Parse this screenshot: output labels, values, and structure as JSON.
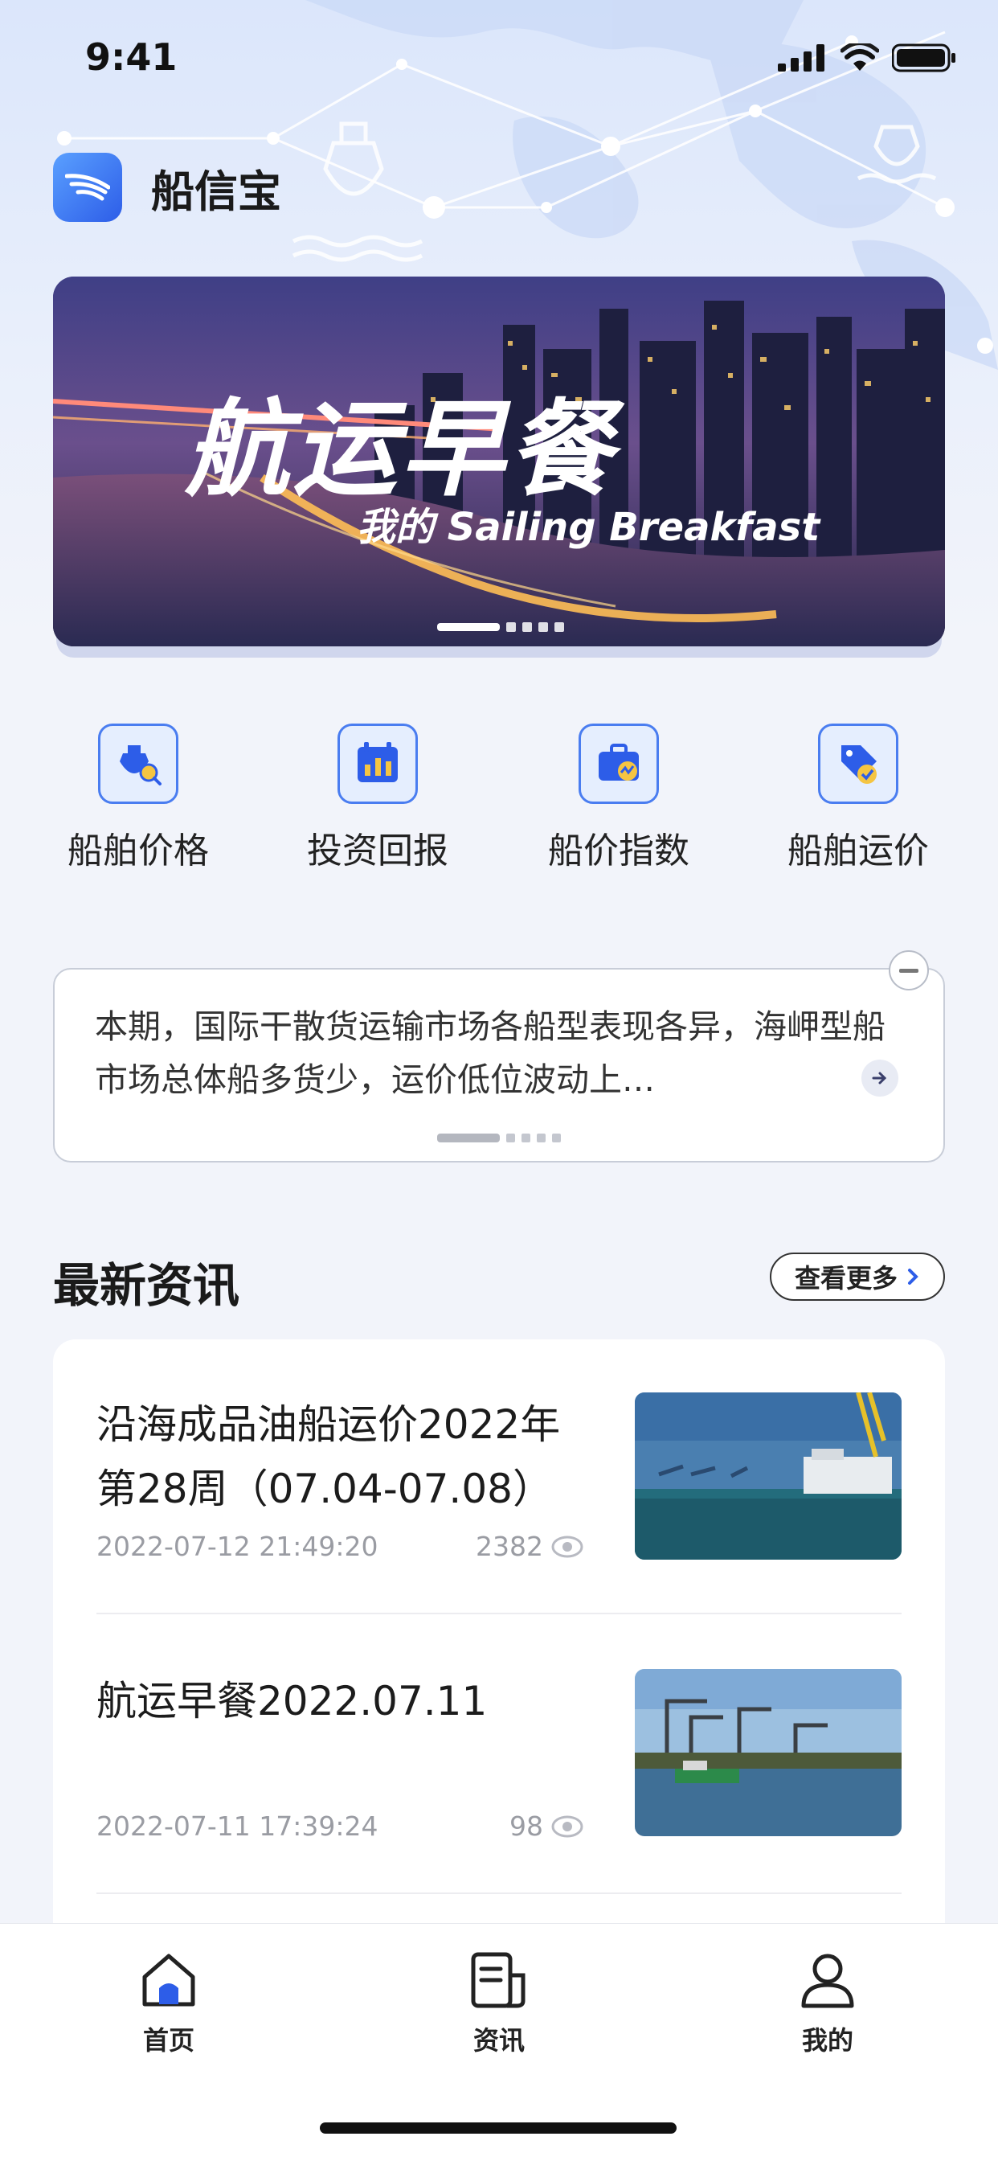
{
  "status_bar": {
    "time": "9:41"
  },
  "app": {
    "name": "船信宝"
  },
  "banner": {
    "title": "航运早餐",
    "subtitle": "我的 Sailing Breakfast",
    "page_count": 5,
    "active_index": 0
  },
  "quick_nav": [
    {
      "label": "船舶价格",
      "icon": "ship-search-icon"
    },
    {
      "label": "投资回报",
      "icon": "bar-chart-calendar-icon"
    },
    {
      "label": "船价指数",
      "icon": "briefcase-chart-icon"
    },
    {
      "label": "船舶运价",
      "icon": "price-tag-check-icon"
    }
  ],
  "notice": {
    "text": "本期，国际干散货运输市场各船型表现各异，海岬型船市场总体船多货少，运价低位波动上…",
    "page_count": 5,
    "active_index": 0
  },
  "news": {
    "section_title": "最新资讯",
    "more_label": "查看更多",
    "items": [
      {
        "title": "沿海成品油船运价2022年第28周（07.04-07.08）",
        "date": "2022-07-12 21:49:20",
        "views": "2382"
      },
      {
        "title": "航运早餐2022.07.11",
        "date": "2022-07-11 17:39:24",
        "views": "98"
      }
    ]
  },
  "tabbar": {
    "tabs": [
      {
        "label": "首页",
        "icon": "home-icon",
        "active": true
      },
      {
        "label": "资讯",
        "icon": "news-icon",
        "active": false
      },
      {
        "label": "我的",
        "icon": "profile-icon",
        "active": false
      }
    ]
  },
  "colors": {
    "accent": "#2d5de8",
    "icon_border": "#4a7df0",
    "text_primary": "#1a1a1a",
    "text_muted": "#9a9ca3"
  }
}
